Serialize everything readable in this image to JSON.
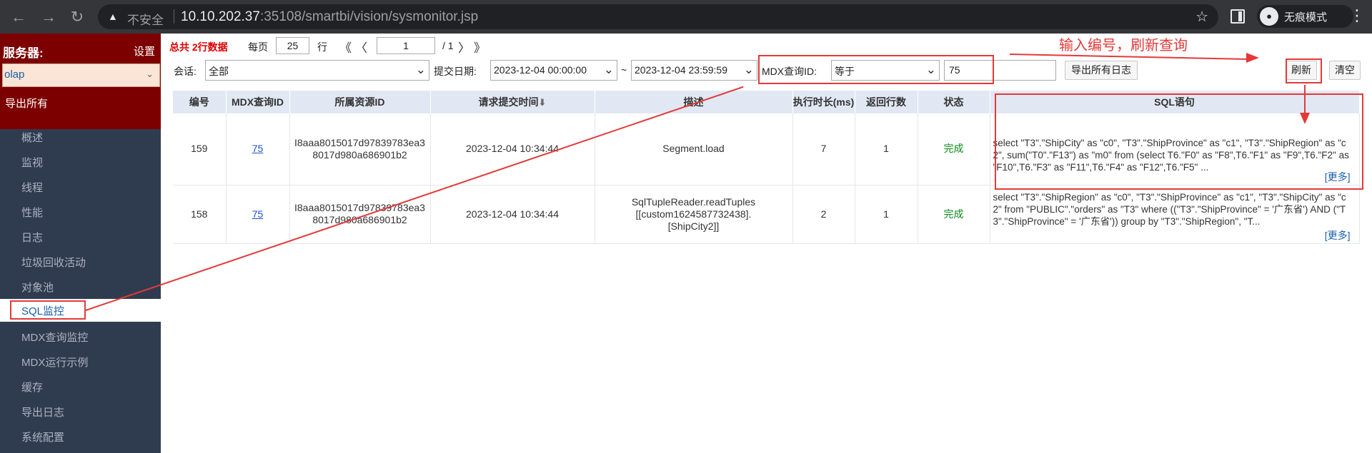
{
  "browser": {
    "warn_glyph": "▲",
    "insecure": "不安全",
    "url_host": "10.10.202.37",
    "url_rest": ":35108/smartbi/vision/sysmonitor.jsp",
    "incognito_label": "无痕模式"
  },
  "sidebar": {
    "server_label": "服务器:",
    "settings": "设置",
    "server_value": "olap",
    "export_all": "导出所有",
    "items": [
      "概述",
      "监视",
      "线程",
      "性能",
      "日志",
      "垃圾回收活动",
      "对象池",
      "SQL监控",
      "MDX查询监控",
      "MDX运行示例",
      "缓存",
      "导出日志",
      "系统配置"
    ],
    "active_index": 7
  },
  "toolbar": {
    "total": "总共  2行数据",
    "per_page_label": "每页",
    "per_page_value": "25",
    "rows_label": "行",
    "first_glyph": "《",
    "prev_glyph": "〈",
    "next_glyph": "〉",
    "last_glyph": "》",
    "page_value": "1",
    "page_total": "/ 1",
    "session_label": "会话:",
    "session_value": "全部",
    "date_label": "提交日期:",
    "date_from": "2023-12-04 00:00:00",
    "tilde": "~",
    "date_to": "2023-12-04 23:59:59",
    "mdx_label": "MDX查询ID:",
    "mdx_op": "等于",
    "mdx_value": "75",
    "export_logs": "导出所有日志",
    "refresh": "刷新",
    "clear": "清空"
  },
  "annotation": {
    "note": "输入编号，刷新查询"
  },
  "table": {
    "headers": [
      "编号",
      "MDX查询ID",
      "所属资源ID",
      "请求提交时间",
      "描述",
      "执行时长(ms)",
      "返回行数",
      "状态",
      "SQL语句"
    ],
    "sort_glyph": "⬇",
    "more_label": "[更多]",
    "rows": [
      {
        "id": "159",
        "mdx_id": "75",
        "resource_id": "I8aaa8015017d97839783ea38017d980a686901b2",
        "time": "2023-12-04 10:34:44",
        "desc": "Segment.load",
        "duration": "7",
        "rows": "1",
        "status": "完成",
        "sql": "select \"T3\".\"ShipCity\" as \"c0\", \"T3\".\"ShipProvince\" as \"c1\", \"T3\".\"ShipRegion\" as \"c2\", sum(\"T0\".\"F13\") as \"m0\" from (select T6.\"F0\" as \"F8\",T6.\"F1\" as \"F9\",T6.\"F2\" as \"F10\",T6.\"F3\" as \"F11\",T6.\"F4\" as \"F12\",T6.\"F5\" ..."
      },
      {
        "id": "158",
        "mdx_id": "75",
        "resource_id": "I8aaa8015017d97839783ea38017d980a686901b2",
        "time": "2023-12-04 10:34:44",
        "desc": "SqlTupleReader.readTuples [[custom1624587732438].[ShipCity2]]",
        "duration": "2",
        "rows": "1",
        "status": "完成",
        "sql": "select \"T3\".\"ShipRegion\" as \"c0\", \"T3\".\"ShipProvince\" as \"c1\", \"T3\".\"ShipCity\" as \"c2\" from \"PUBLIC\".\"orders\" as \"T3\" where ((\"T3\".\"ShipProvince\" = '广东省') AND (\"T3\".\"ShipProvince\" = '广东省')) group by \"T3\".\"ShipRegion\", \"T..."
      }
    ]
  },
  "colors": {
    "sidebar_bg": "#2f3c4f",
    "sidebar_head": "#7d0000",
    "annotation_red": "#e43939",
    "header_bg": "#e2e8f3",
    "status_green": "#0b8a1b"
  }
}
